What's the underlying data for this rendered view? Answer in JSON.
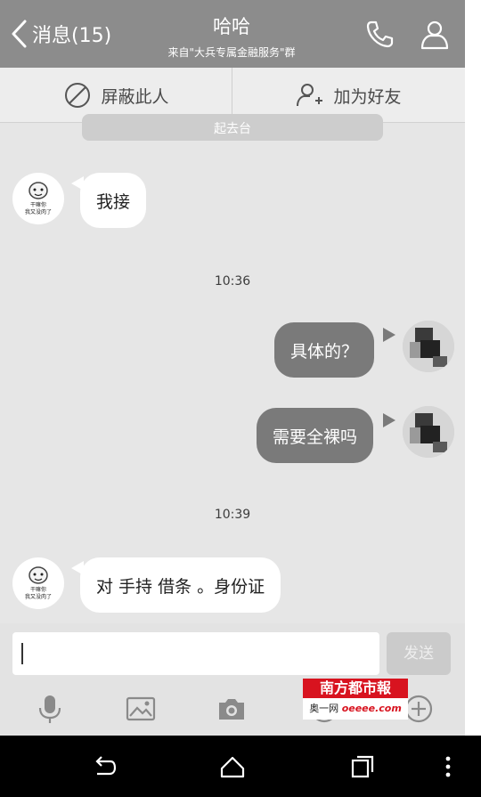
{
  "header": {
    "back_label": "消息(15)",
    "title": "哈哈",
    "subtitle": "来自\"大兵专属金融服务\"群",
    "icons": [
      "back-chevron-icon",
      "phone-icon",
      "profile-icon"
    ]
  },
  "actions": {
    "block_label": "屏蔽此人",
    "add_friend_label": "加为好友"
  },
  "system_notice": "起去台",
  "messages": [
    {
      "side": "in",
      "text": "我接"
    },
    {
      "time": "10:36"
    },
    {
      "side": "out",
      "text": "具体的？"
    },
    {
      "side": "out",
      "text": "需要全裸吗"
    },
    {
      "time": "10:39"
    },
    {
      "side": "in",
      "text": "对 手持 借条 。身份证"
    }
  ],
  "avatar_caption": "干嘛你 我又没肉了",
  "input": {
    "value": "",
    "send_label": "发送"
  },
  "toolbar_icons": [
    "microphone-icon",
    "image-icon",
    "camera-icon",
    "emoji-icon",
    "plus-icon"
  ],
  "watermark": {
    "title": "南方都市報",
    "line": "奥一网",
    "site": "oeeee.com"
  },
  "colors": {
    "header_bg": "#8c8c8c",
    "chat_bg": "#e6e6e6",
    "incoming_bubble": "#ffffff",
    "outgoing_bubble": "#7a7a7a",
    "watermark_red": "#d8131f"
  }
}
